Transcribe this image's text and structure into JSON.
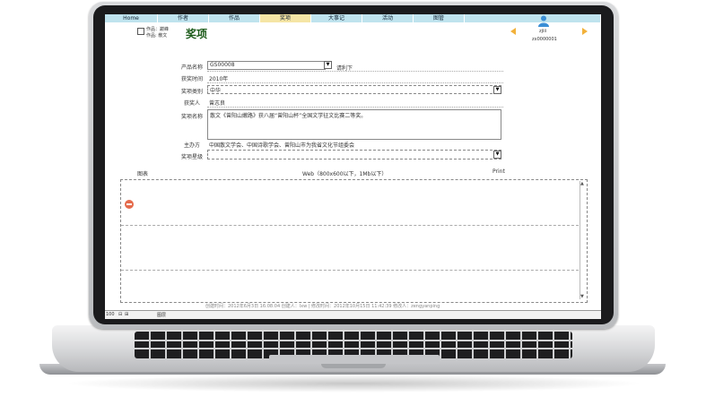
{
  "tabs": [
    "Home",
    "作者",
    "作品",
    "奖项",
    "大事记",
    "活动",
    "图管",
    ""
  ],
  "active_tab": "奖项",
  "breadcrumb": {
    "line1": "作品：巅峰",
    "line2": "作品: 散文"
  },
  "page_title": "奖项",
  "user": {
    "name": "zjiii",
    "id": "zx0000001"
  },
  "form": {
    "product_code": {
      "label": "产品名称",
      "value": "GS00008",
      "extra": "请利下"
    },
    "award_date": {
      "label": "获奖时间",
      "value": "2010年"
    },
    "award_category": {
      "label": "奖项类别",
      "value": "中华"
    },
    "winner": {
      "label": "获奖人",
      "value": "曾志良"
    },
    "award_name": {
      "label": "奖项名称",
      "value": "散文《曾阳山嫩路》获八届“曾阳山杯”全国文学征文比赛二等奖。"
    },
    "organizer": {
      "label": "主办方",
      "value": "中国散文学会、中国诗歌学会、曾阳山市为我省文化节组委会"
    },
    "award_level": {
      "label": "奖项星级",
      "value": ""
    }
  },
  "editor": {
    "left_label": "图表",
    "center_label": "Web（800x600以下，1Mb以下）",
    "right_label": "Print"
  },
  "statusbar": {
    "zoom": "100",
    "layout_label": "图层",
    "meta": "创建时间：2012年6月3日 16:08:04 创建人：lxw | 修改时间：2012年10月15日 11:42:39 修改人：zengyanping"
  },
  "colors": {
    "tab_bg": "#bfe3ee",
    "tab_active": "#f5e5a5",
    "title": "#1a5a18",
    "arrow": "#f2b13a",
    "remove": "#e56b4c"
  }
}
